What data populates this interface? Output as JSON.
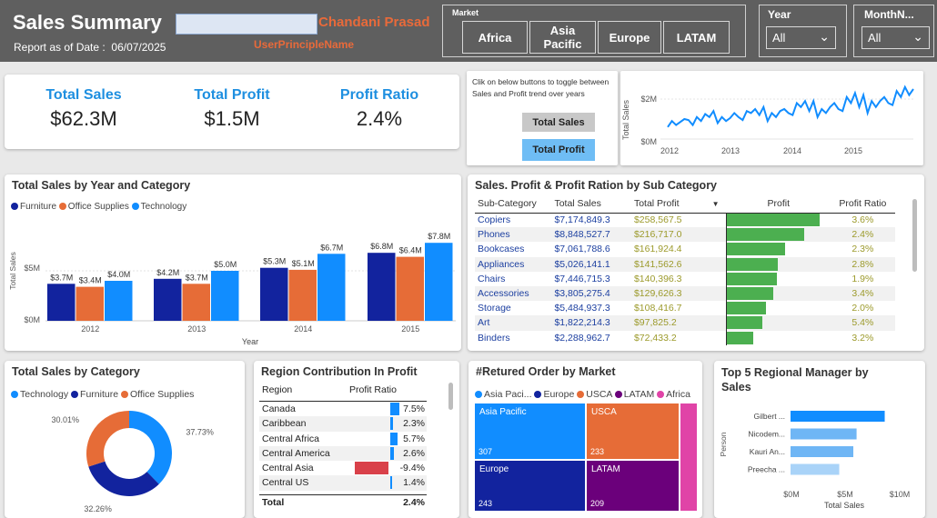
{
  "header": {
    "title": "Sales Summary",
    "as_of_label": "Report as of Date :",
    "as_of_date": "06/07/2025",
    "user_name": "Chandani Prasad",
    "upn_label": "UserPrincipleName"
  },
  "market_slicer": {
    "label": "Market",
    "options": [
      "Africa",
      "Asia Pacific",
      "Europe",
      "LATAM"
    ]
  },
  "year_slicer": {
    "label": "Year",
    "value": "All"
  },
  "month_slicer": {
    "label": "MonthN...",
    "value": "All"
  },
  "kpis": [
    {
      "label": "Total Sales",
      "value": "$62.3M"
    },
    {
      "label": "Total Profit",
      "value": "$1.5M"
    },
    {
      "label": "Profit Ratio",
      "value": "2.4%"
    }
  ],
  "trend": {
    "instruction": "Clik on below buttons to toggle between Sales and Profit trend over years",
    "btn_sales": "Total Sales",
    "btn_profit": "Total Profit",
    "chart_data": {
      "type": "line",
      "ylabel": "Total Sales",
      "y_ticks": [
        "$0M",
        "$2M"
      ],
      "x_ticks": [
        "2012",
        "2013",
        "2014",
        "2015"
      ],
      "values": [
        0.6,
        0.9,
        0.7,
        0.85,
        1.0,
        0.95,
        0.7,
        1.1,
        0.9,
        1.25,
        1.1,
        1.4,
        0.8,
        1.1,
        0.9,
        1.05,
        1.3,
        1.1,
        0.95,
        1.4,
        1.3,
        1.5,
        1.2,
        1.6,
        0.9,
        1.3,
        1.1,
        1.4,
        1.5,
        1.3,
        1.2,
        1.8,
        1.6,
        1.9,
        1.4,
        1.9,
        1.1,
        1.5,
        1.3,
        1.6,
        1.8,
        1.5,
        1.4,
        2.1,
        1.8,
        2.3,
        1.6,
        2.2,
        1.3,
        1.9,
        1.6,
        1.9,
        2.1,
        1.8,
        1.7,
        2.4,
        2.1,
        2.6,
        2.2,
        2.5
      ]
    }
  },
  "sales_year_cat": {
    "title": "Total Sales by Year and Category",
    "legend": [
      {
        "name": "Furniture",
        "color": "#12239e"
      },
      {
        "name": "Office Supplies",
        "color": "#e66c37"
      },
      {
        "name": "Technology",
        "color": "#118dff"
      }
    ],
    "chart_data": {
      "type": "bar",
      "categories": [
        "2012",
        "2013",
        "2014",
        "2015"
      ],
      "series": [
        {
          "name": "Furniture",
          "values": [
            3.7,
            4.2,
            5.3,
            6.8
          ],
          "labels": [
            "$3.7M",
            "$4.2M",
            "$5.3M",
            "$6.8M"
          ]
        },
        {
          "name": "Office Supplies",
          "values": [
            3.4,
            3.7,
            5.1,
            6.4
          ],
          "labels": [
            "$3.4M",
            "$3.7M",
            "$5.1M",
            "$6.4M"
          ]
        },
        {
          "name": "Technology",
          "values": [
            4.0,
            5.0,
            6.7,
            7.8
          ],
          "labels": [
            "$4.0M",
            "$5.0M",
            "$6.7M",
            "$7.8M"
          ]
        }
      ],
      "xlabel": "Year",
      "ylabel": "Total Sales",
      "y_ticks": [
        "$0M",
        "$5M"
      ],
      "ylim": [
        0,
        9
      ]
    }
  },
  "subcat": {
    "title": "Sales. Profit & Profit Ration by Sub Category",
    "columns": [
      "Sub-Category",
      "Total Sales",
      "Total Profit",
      "Profit",
      "Profit Ratio"
    ],
    "rows": [
      {
        "name": "Copiers",
        "sales": "$7,174,849.3",
        "profit": "$258,567.5",
        "ratio": "3.6%",
        "bar": 258567.5
      },
      {
        "name": "Phones",
        "sales": "$8,848,527.7",
        "profit": "$216,717.0",
        "ratio": "2.4%",
        "bar": 216717.0
      },
      {
        "name": "Bookcases",
        "sales": "$7,061,788.6",
        "profit": "$161,924.4",
        "ratio": "2.3%",
        "bar": 161924.4
      },
      {
        "name": "Appliances",
        "sales": "$5,026,141.1",
        "profit": "$141,562.6",
        "ratio": "2.8%",
        "bar": 141562.6
      },
      {
        "name": "Chairs",
        "sales": "$7,446,715.3",
        "profit": "$140,396.3",
        "ratio": "1.9%",
        "bar": 140396.3
      },
      {
        "name": "Accessories",
        "sales": "$3,805,275.4",
        "profit": "$129,626.3",
        "ratio": "3.4%",
        "bar": 129626.3
      },
      {
        "name": "Storage",
        "sales": "$5,484,937.3",
        "profit": "$108,416.7",
        "ratio": "2.0%",
        "bar": 108416.7
      },
      {
        "name": "Art",
        "sales": "$1,822,214.3",
        "profit": "$97,825.2",
        "ratio": "5.4%",
        "bar": 97825.2
      },
      {
        "name": "Binders",
        "sales": "$2,288,962.7",
        "profit": "$72,433.2",
        "ratio": "3.2%",
        "bar": 72433.2
      }
    ]
  },
  "donut": {
    "title": "Total Sales by Category",
    "legend": [
      {
        "name": "Technology",
        "color": "#118dff"
      },
      {
        "name": "Furniture",
        "color": "#12239e"
      },
      {
        "name": "Office Supplies",
        "color": "#e66c37"
      }
    ],
    "chart_data": {
      "type": "pie",
      "slices": [
        {
          "name": "Technology",
          "value": 37.73,
          "label": "37.73%",
          "color": "#118dff"
        },
        {
          "name": "Furniture",
          "value": 32.26,
          "label": "32.26%",
          "color": "#12239e"
        },
        {
          "name": "Office Supplies",
          "value": 30.01,
          "label": "30.01%",
          "color": "#e66c37"
        }
      ]
    }
  },
  "region": {
    "title": "Region Contribution In Profit",
    "col_region": "Region",
    "col_ratio": "Profit Ratio",
    "rows": [
      {
        "name": "Canada",
        "ratio": "7.5%",
        "value": 7.5
      },
      {
        "name": "Caribbean",
        "ratio": "2.3%",
        "value": 2.3
      },
      {
        "name": "Central Africa",
        "ratio": "5.7%",
        "value": 5.7
      },
      {
        "name": "Central America",
        "ratio": "2.6%",
        "value": 2.6
      },
      {
        "name": "Central Asia",
        "ratio": "-9.4%",
        "value": -9.4
      },
      {
        "name": "Central US",
        "ratio": "1.4%",
        "value": 1.4
      }
    ],
    "total_label": "Total",
    "total_value": "2.4%"
  },
  "returned": {
    "title": "#Retured Order by Market",
    "legend": [
      {
        "name": "Asia Paci...",
        "color": "#118dff"
      },
      {
        "name": "Europe",
        "color": "#12239e"
      },
      {
        "name": "USCA",
        "color": "#e66c37"
      },
      {
        "name": "LATAM",
        "color": "#6b007b"
      },
      {
        "name": "Africa",
        "color": "#e044a7"
      }
    ],
    "chart_data": {
      "type": "treemap",
      "items": [
        {
          "name": "Asia Pacific",
          "value": 307
        },
        {
          "name": "USCA",
          "value": 233
        },
        {
          "name": "Europe",
          "value": 243
        },
        {
          "name": "LATAM",
          "value": 209
        },
        {
          "name": "Africa",
          "value": null
        }
      ]
    }
  },
  "managers": {
    "title": "Top 5 Regional Manager by Sales",
    "ylabel": "Person",
    "xlabel": "Total Sales",
    "x_ticks": [
      "$0M",
      "$5M",
      "$10M"
    ],
    "chart_data": {
      "type": "bar",
      "orientation": "horizontal",
      "categories": [
        "Gilbert ...",
        "Nicodem...",
        "Kauri An...",
        "Preecha ..."
      ],
      "values": [
        8.7,
        6.1,
        5.8,
        4.5
      ],
      "xlim": [
        0,
        10
      ]
    }
  }
}
